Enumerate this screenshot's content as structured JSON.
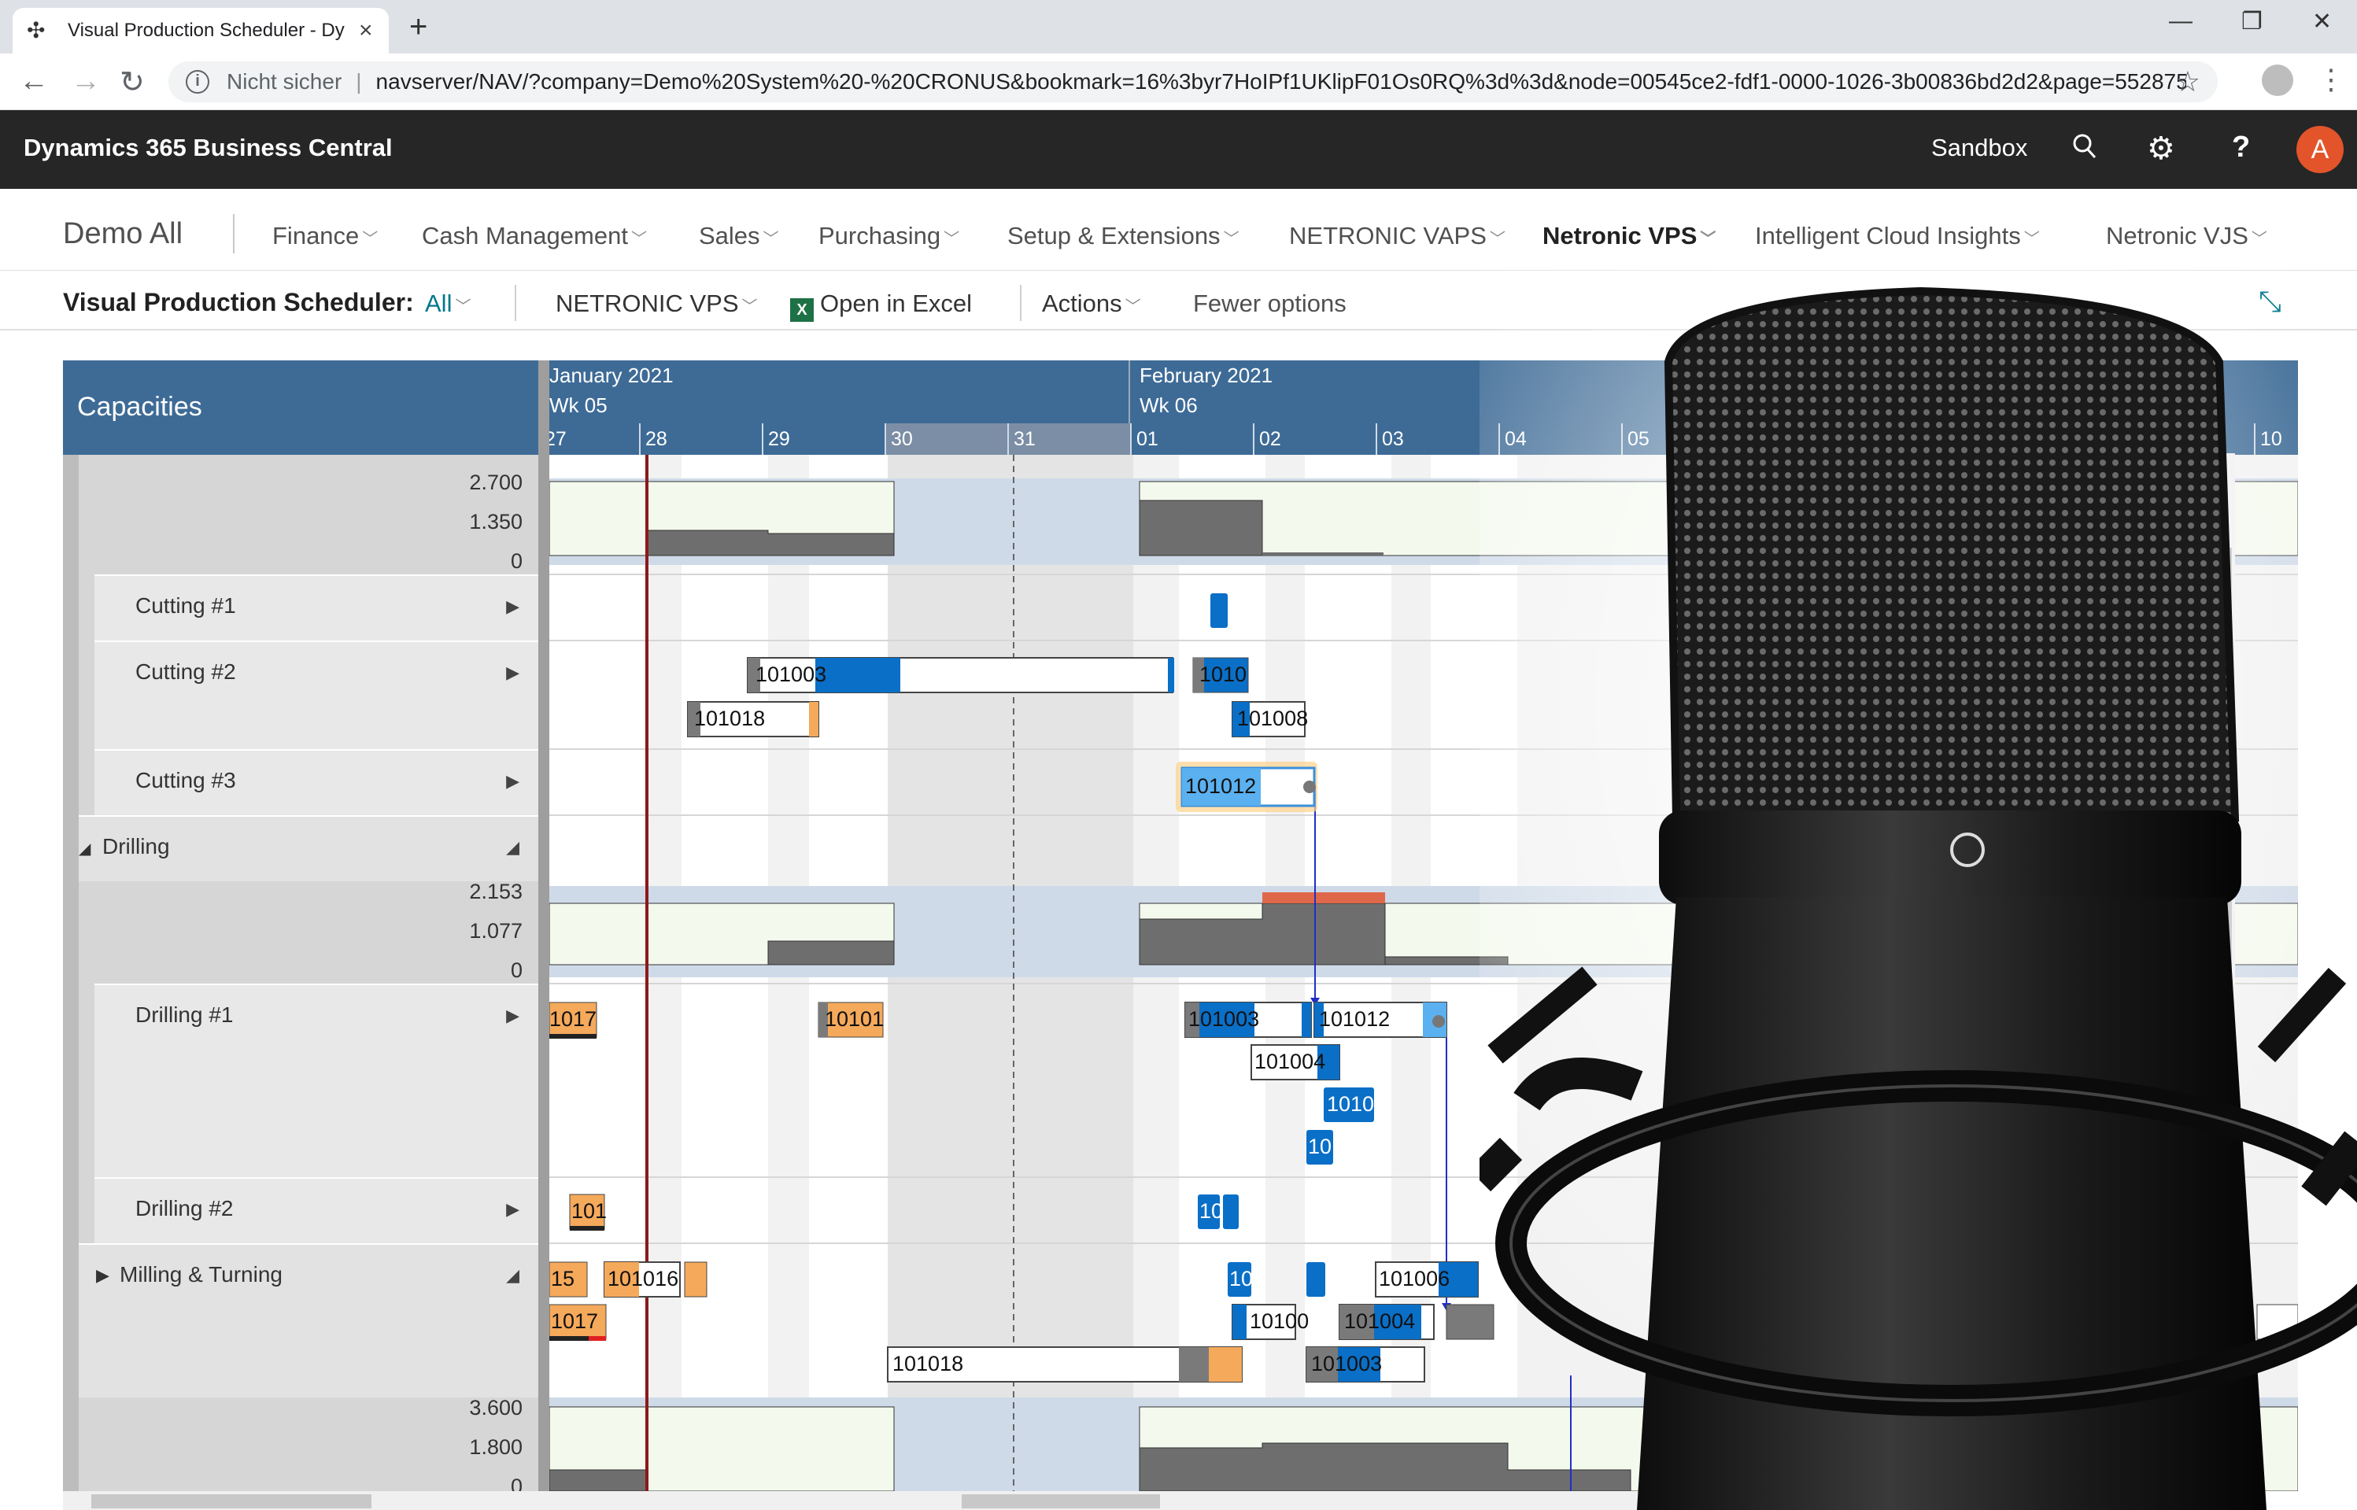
{
  "browser": {
    "tab_title": "Visual Production Scheduler - Dy",
    "security_label": "Nicht sicher",
    "url": "navserver/NAV/?company=Demo%20System%20-%20CRONUS&bookmark=16%3byr7HoIPf1UKlipF01Os0RQ%3d%3d&node=00545ce2-fdf1-0000-1026-3b00836bd2d2&page=552875..."
  },
  "header": {
    "brand": "Dynamics 365 Business Central",
    "environment": "Sandbox",
    "avatar_initial": "A"
  },
  "nav": {
    "company": "Demo All",
    "items": [
      "Finance",
      "Cash Management",
      "Sales",
      "Purchasing",
      "Setup & Extensions",
      "NETRONIC VAPS",
      "Netronic VPS",
      "Intelligent Cloud Insights",
      "Netronic VJS"
    ],
    "active": "Netronic VPS"
  },
  "actionbar": {
    "page_title": "Visual Production Scheduler:",
    "filter": "All",
    "vps_menu": "NETRONIC VPS",
    "excel": "Open in Excel",
    "actions": "Actions",
    "fewer": "Fewer options"
  },
  "scheduler": {
    "capacities_label": "Capacities",
    "months": [
      {
        "label": "January 2021",
        "week": "Wk 05"
      },
      {
        "label": "February 2021",
        "week": "Wk 06"
      }
    ],
    "days": [
      "27",
      "28",
      "29",
      "30",
      "31",
      "01",
      "02",
      "03",
      "04",
      "05",
      "10"
    ],
    "resources": {
      "cutting1": "Cutting #1",
      "cutting2": "Cutting #2",
      "cutting3": "Cutting #3",
      "drilling": "Drilling",
      "drilling1": "Drilling #1",
      "drilling2": "Drilling #2",
      "milling": "Milling & Turning"
    },
    "axis_top": {
      "max": "2.700",
      "mid": "1.350",
      "min": "0"
    },
    "axis_drilling": {
      "max": "2.153",
      "mid": "1.077",
      "min": "0"
    },
    "axis_milling": {
      "max": "3.600",
      "mid": "1.800",
      "min": "0"
    },
    "bars": {
      "b_c2_a": "101003",
      "b_c2_b": "1010",
      "b_c2_c": "101018",
      "b_c2_d": "101008",
      "b_c3_a": "101012",
      "b_d1_a": "1017",
      "b_d1_b": "10101",
      "b_d1_c": "101003",
      "b_d1_d": "101012",
      "b_d1_e": "101004",
      "b_d1_f": "1010",
      "b_d1_g": "10",
      "b_d2_a": "101",
      "b_d2_b": "10",
      "b_m_a": "15",
      "b_m_b": "101016",
      "b_m_c": "1017",
      "b_m_d": "101018",
      "b_m_e": "10",
      "b_m_f": "101006",
      "b_m_g": "10100",
      "b_m_h": "101004",
      "b_m_i": "101003"
    }
  },
  "colors": {
    "header_blue": "#3e6b96",
    "bar_blue": "#0a6fc7",
    "bar_orange": "#f5a95b",
    "load_gray": "#6e6e6e",
    "overload_red": "#e0684a"
  }
}
